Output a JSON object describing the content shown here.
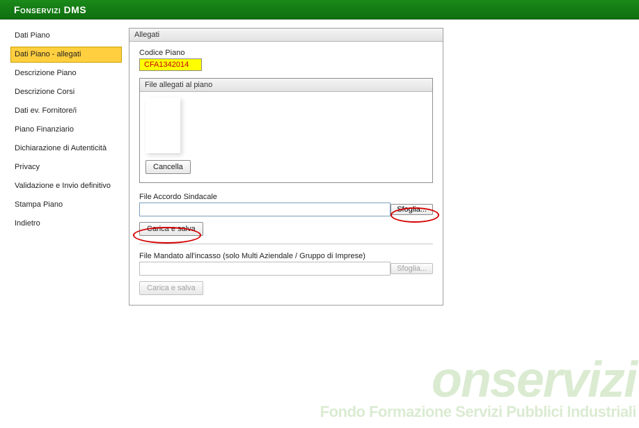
{
  "header": {
    "title": "Fonservizi DMS"
  },
  "sidebar": {
    "items": [
      {
        "label": "Dati Piano",
        "selected": false
      },
      {
        "label": "Dati Piano - allegati",
        "selected": true
      },
      {
        "label": "Descrizione Piano",
        "selected": false
      },
      {
        "label": "Descrizione Corsi",
        "selected": false
      },
      {
        "label": "Dati ev. Fornitore/i",
        "selected": false
      },
      {
        "label": "Piano Finanziario",
        "selected": false
      },
      {
        "label": "Dichiarazione di Autenticità",
        "selected": false
      },
      {
        "label": "Privacy",
        "selected": false
      },
      {
        "label": "Validazione e Invio definitivo",
        "selected": false
      },
      {
        "label": "Stampa Piano",
        "selected": false
      },
      {
        "label": "Indietro",
        "selected": false
      }
    ]
  },
  "panel": {
    "title": "Allegati",
    "codice_label": "Codice Piano",
    "codice_value": "CFA1342014",
    "fieldset_title": "File allegati al piano",
    "cancella_label": "Cancella",
    "accordo_label": "File Accordo Sindacale",
    "browse_label": "Sfoglia...",
    "carica_label": "Carica e salva",
    "mandato_label": "File Mandato all'incasso (solo Multi Aziendale / Gruppo di Imprese)"
  },
  "watermark": {
    "logo": "onservizi",
    "tagline": "Fondo Formazione Servizi Pubblici Industriali"
  }
}
